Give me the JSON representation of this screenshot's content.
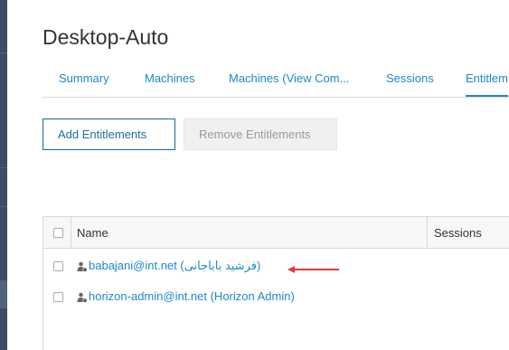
{
  "page": {
    "title": "Desktop-Auto"
  },
  "tabs": [
    {
      "label": "Summary"
    },
    {
      "label": "Machines"
    },
    {
      "label": "Machines (View Com..."
    },
    {
      "label": "Sessions"
    },
    {
      "label": "Entitlem"
    }
  ],
  "toolbar": {
    "add_label": "Add Entitlements",
    "remove_label": "Remove Entitlements"
  },
  "table": {
    "columns": [
      "Name",
      "Sessions"
    ],
    "rows": [
      {
        "name": "babajani@int.net (فرشید باباجانی)"
      },
      {
        "name": "horizon-admin@int.net (Horizon Admin)"
      }
    ]
  },
  "colors": {
    "accent": "#1e88c7",
    "rail": "#3b4d61",
    "annotation_arrow": "#e53935"
  },
  "icons": {
    "user": "user-group-icon",
    "arrow": "red-arrow-left-icon"
  }
}
